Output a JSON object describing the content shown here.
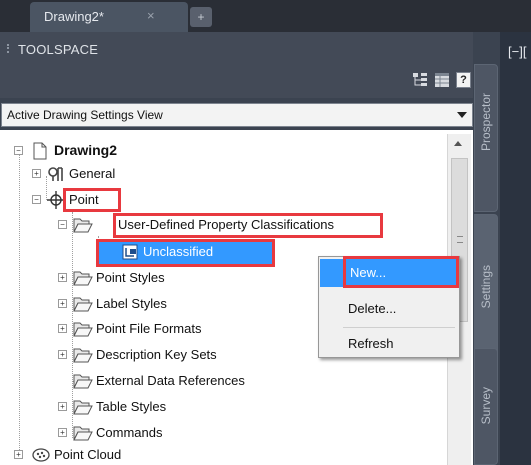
{
  "document_tab": {
    "label": "Drawing2*",
    "close_glyph": "×",
    "new_tab_glyph": "+"
  },
  "toolspace": {
    "title": "TOOLSPACE"
  },
  "toolbar": {
    "help_label": "?"
  },
  "view_selector": {
    "selected": "Active Drawing Settings View"
  },
  "canvas": {
    "viewport_label": "[−]["
  },
  "side_tabs": {
    "prospector": "Prospector",
    "settings": "Settings",
    "survey": "Survey"
  },
  "tree": {
    "root": "Drawing2",
    "general": "General",
    "point": "Point",
    "udp_classifications": "User-Defined Property Classifications",
    "unclassified": "Unclassified",
    "point_styles": "Point Styles",
    "label_styles": "Label Styles",
    "point_file_formats": "Point File Formats",
    "description_key_sets": "Description Key Sets",
    "external_data_references": "External Data References",
    "table_styles": "Table Styles",
    "commands": "Commands",
    "point_cloud": "Point Cloud"
  },
  "context_menu": {
    "new": "New...",
    "delete": "Delete...",
    "refresh": "Refresh"
  },
  "colors": {
    "selection": "#3399ff",
    "annotation": "#e8393f",
    "panel": "#434a57"
  }
}
